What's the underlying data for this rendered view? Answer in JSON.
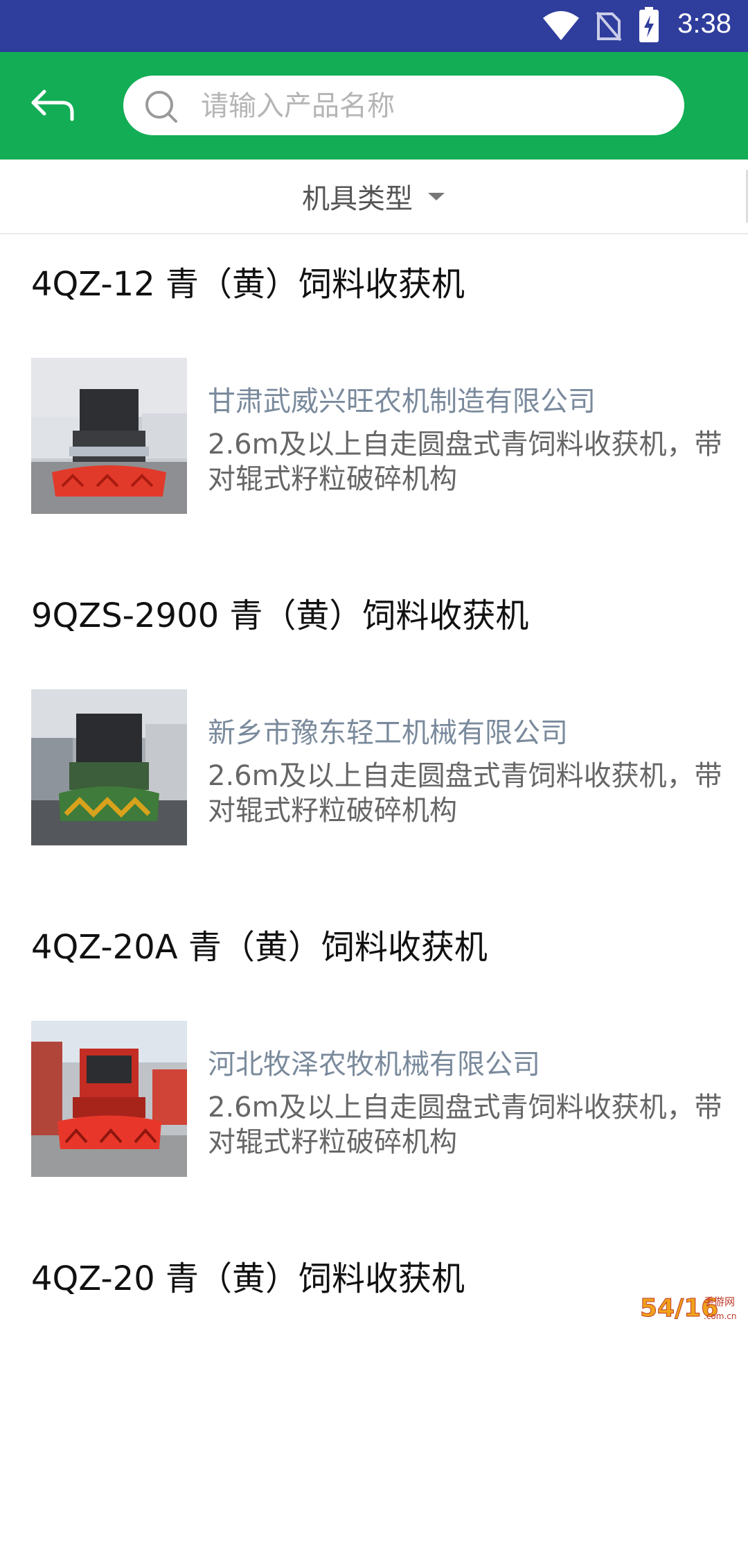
{
  "status_bar": {
    "time": "3:38"
  },
  "search": {
    "placeholder": "请输入产品名称"
  },
  "filter": {
    "label": "机具类型"
  },
  "products": [
    {
      "title": "4QZ-12 青（黄）饲料收获机",
      "company": "甘肃武威兴旺农机制造有限公司",
      "description": "2.6m及以上自走圆盘式青饲料收获机，带对辊式籽粒破碎机构",
      "banner_color": "#e23a2a"
    },
    {
      "title": "9QZS-2900 青（黄）饲料收获机",
      "company": "新乡市豫东轻工机械有限公司",
      "description": "2.6m及以上自走圆盘式青饲料收获机，带对辊式籽粒破碎机构",
      "banner_color": "#3f7b3a"
    },
    {
      "title": "4QZ-20A 青（黄）饲料收获机",
      "company": "河北牧泽农牧机械有限公司",
      "description": "2.6m及以上自走圆盘式青饲料收获机，带对辊式籽粒破碎机构",
      "banner_color": "#e23a2a"
    },
    {
      "title": "4QZ-20 青（黄）饲料收获机"
    }
  ],
  "watermark": {
    "text": "54/16手游网",
    "sub": ".com.cn"
  },
  "colors": {
    "status_bar": "#2f3d9c",
    "app_bar": "#12ad55",
    "company_text": "#7a8a9c"
  }
}
